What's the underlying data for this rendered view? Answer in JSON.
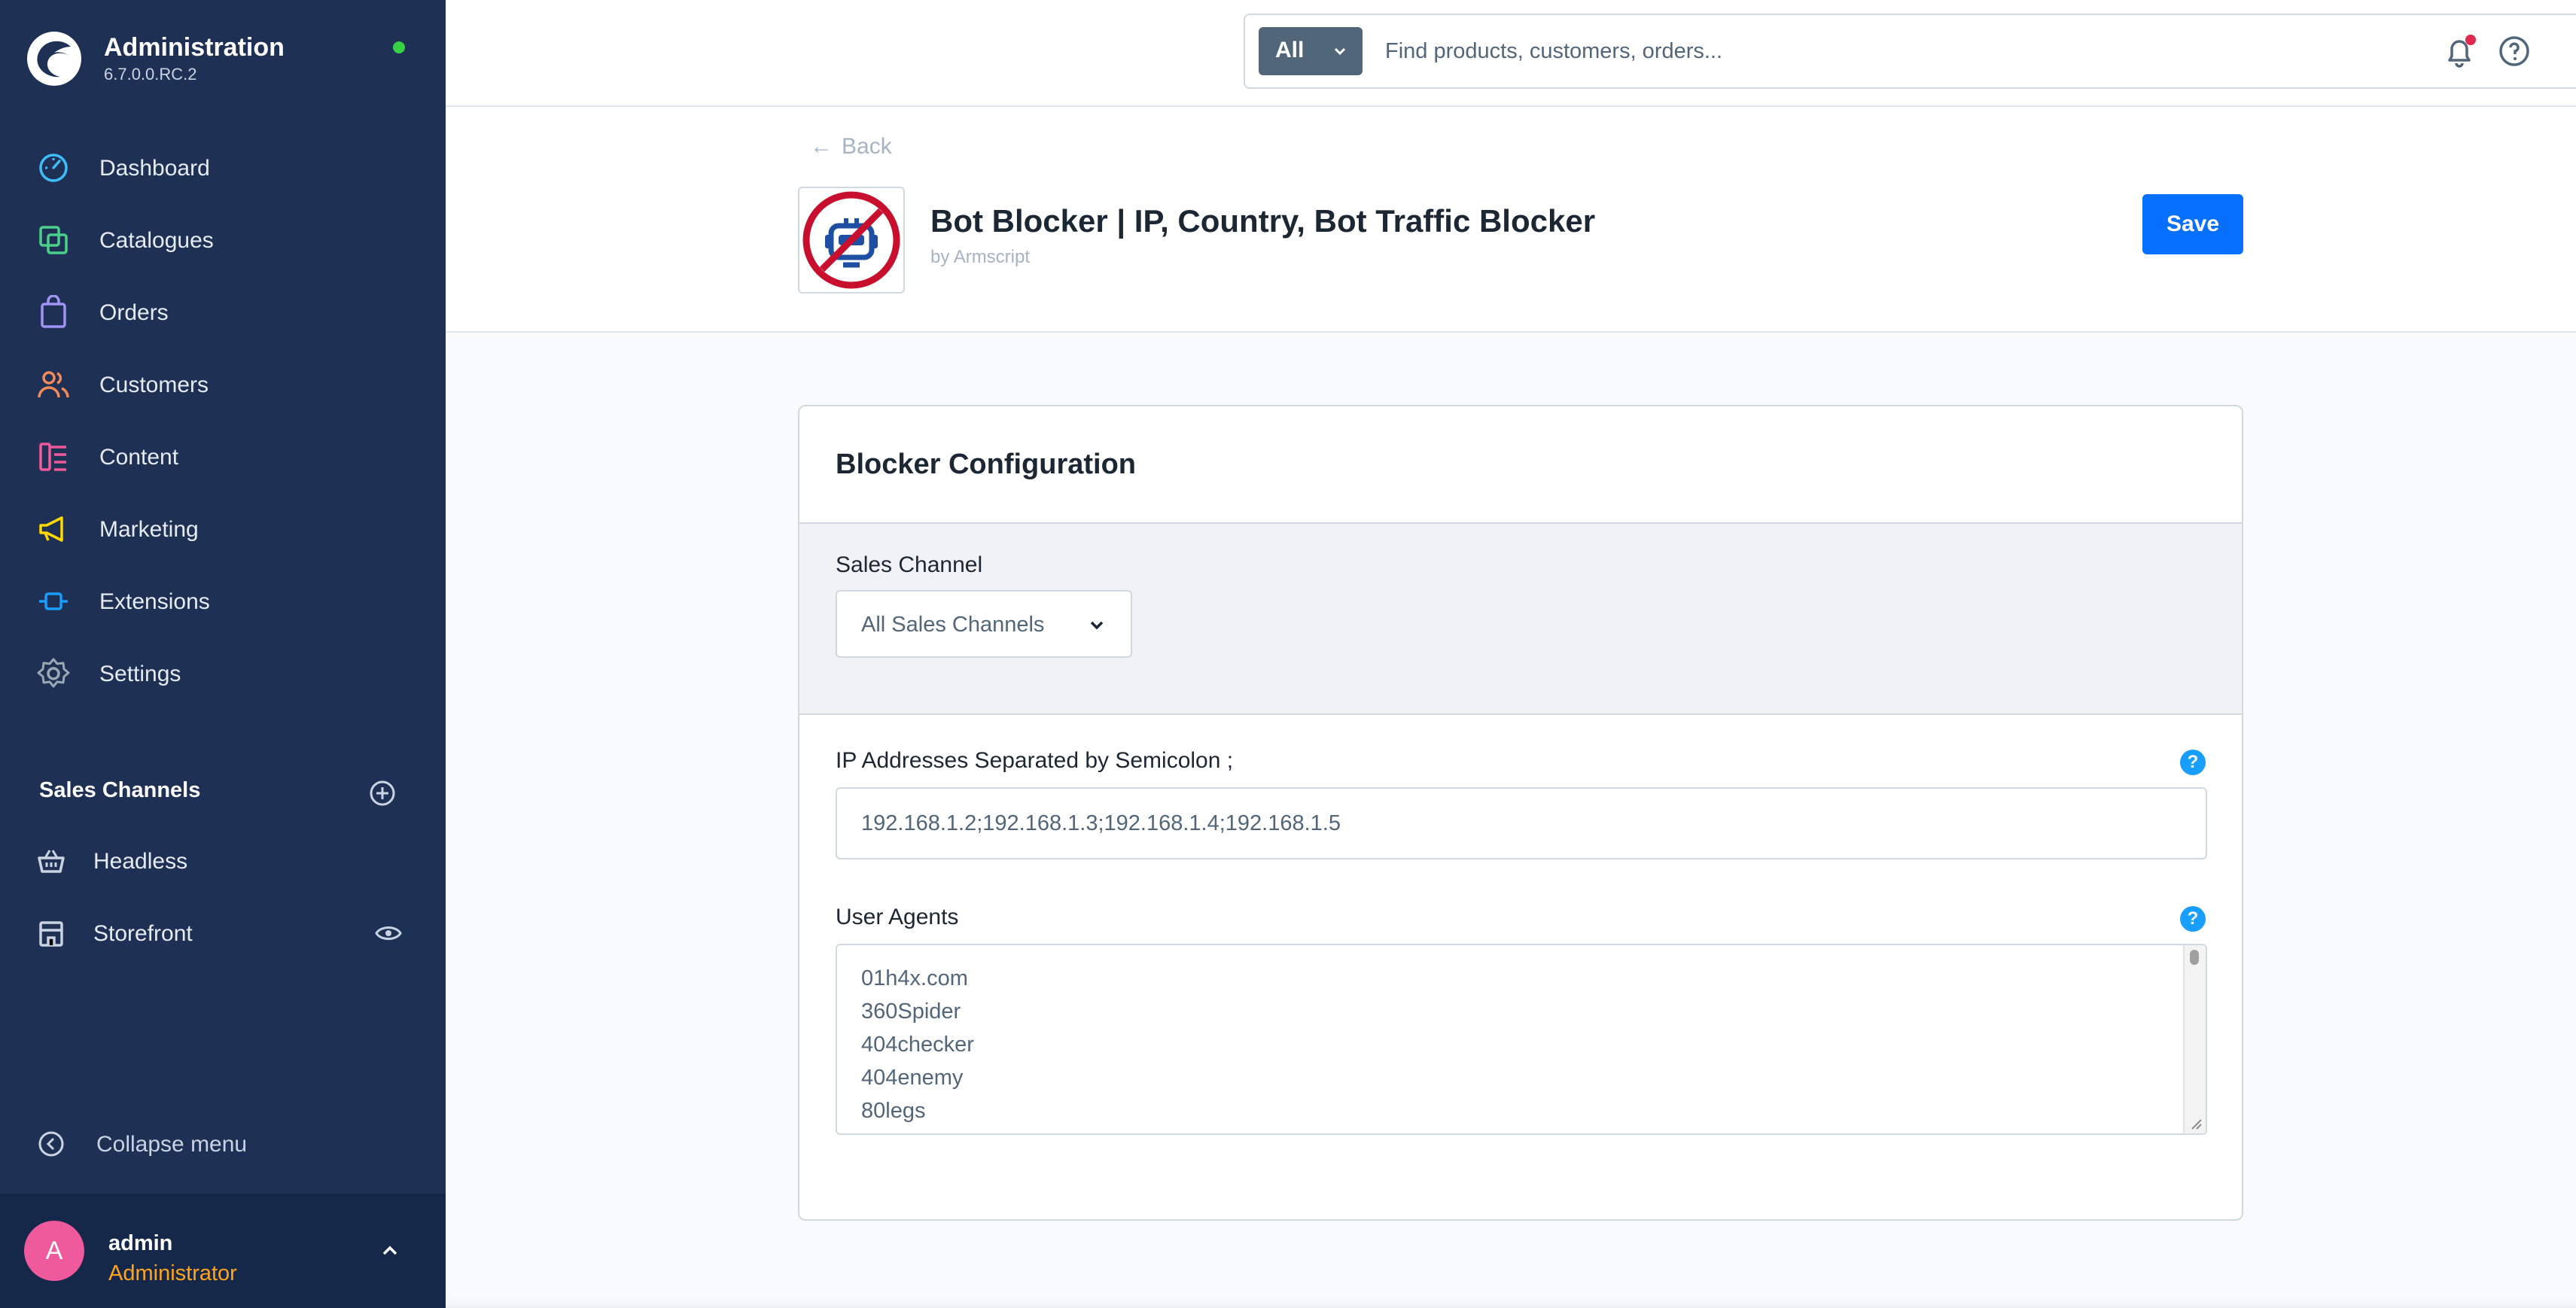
{
  "app": {
    "name": "Administration",
    "version": "6.7.0.0.RC.2"
  },
  "nav": {
    "items": [
      {
        "label": "Dashboard",
        "icon": "dashboard-icon",
        "color": "#3ebdf8"
      },
      {
        "label": "Catalogues",
        "icon": "catalogue-icon",
        "color": "#4ad08a"
      },
      {
        "label": "Orders",
        "icon": "orders-icon",
        "color": "#a093f5"
      },
      {
        "label": "Customers",
        "icon": "customers-icon",
        "color": "#f38a5a"
      },
      {
        "label": "Content",
        "icon": "content-icon",
        "color": "#ef5a9d"
      },
      {
        "label": "Marketing",
        "icon": "marketing-icon",
        "color": "#ffd700"
      },
      {
        "label": "Extensions",
        "icon": "extensions-icon",
        "color": "#189eff"
      },
      {
        "label": "Settings",
        "icon": "settings-icon",
        "color": "#9aa8b5"
      }
    ]
  },
  "sales_channels": {
    "title": "Sales Channels",
    "items": [
      {
        "label": "Headless",
        "icon": "basket-icon"
      },
      {
        "label": "Storefront",
        "icon": "storefront-icon"
      }
    ]
  },
  "collapse_label": "Collapse menu",
  "user": {
    "initial": "A",
    "name": "admin",
    "role": "Administrator"
  },
  "search": {
    "type": "All",
    "placeholder": "Find products, customers, orders..."
  },
  "header": {
    "back_label": "Back",
    "title": "Bot Blocker | IP, Country, Bot Traffic Blocker",
    "author": "by Armscript",
    "save_label": "Save"
  },
  "config": {
    "card_title": "Blocker Configuration",
    "sales_channel_label": "Sales Channel",
    "sales_channel_value": "All Sales Channels",
    "ip_label": "IP Addresses Separated by Semicolon ;",
    "ip_value": "192.168.1.2;192.168.1.3;192.168.1.4;192.168.1.5",
    "user_agents_label": "User Agents",
    "user_agents": [
      "01h4x.com",
      "360Spider",
      "404checker",
      "404enemy",
      "80legs"
    ],
    "help_glyph": "?"
  },
  "colors": {
    "sidebar": "#1e3054",
    "primary": "#0870ff",
    "accent_role": "#ffa41b",
    "status_online": "#37d046"
  }
}
